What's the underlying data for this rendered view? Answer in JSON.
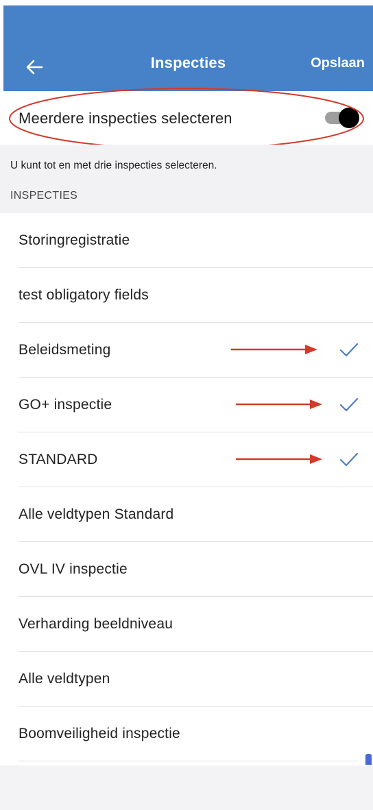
{
  "colors": {
    "app_bar": "#4781c8",
    "accent": "#4a7fc1",
    "annotation": "#d23a2a",
    "switch_thumb": "#000000",
    "switch_track": "#9e9e9e"
  },
  "app_bar": {
    "title": "Inspecties",
    "save_label": "Opslaan",
    "back_icon": "arrow-left-icon"
  },
  "multi_select": {
    "label": "Meerdere inspecties selecteren",
    "enabled": true
  },
  "info": {
    "text": "U kunt tot en met drie inspecties selecteren."
  },
  "section": {
    "header": "INSPECTIES"
  },
  "inspections": [
    {
      "label": "Storingregistratie",
      "checked": false
    },
    {
      "label": "test obligatory fields",
      "checked": false
    },
    {
      "label": "Beleidsmeting",
      "checked": true
    },
    {
      "label": "GO+ inspectie",
      "checked": true
    },
    {
      "label": "STANDARD",
      "checked": true
    },
    {
      "label": "Alle veldtypen Standard",
      "checked": false
    },
    {
      "label": "OVL IV inspectie",
      "checked": false
    },
    {
      "label": "Verharding beeldniveau",
      "checked": false
    },
    {
      "label": "Alle veldtypen",
      "checked": false
    },
    {
      "label": "Boomveiligheid inspectie",
      "checked": false
    }
  ]
}
